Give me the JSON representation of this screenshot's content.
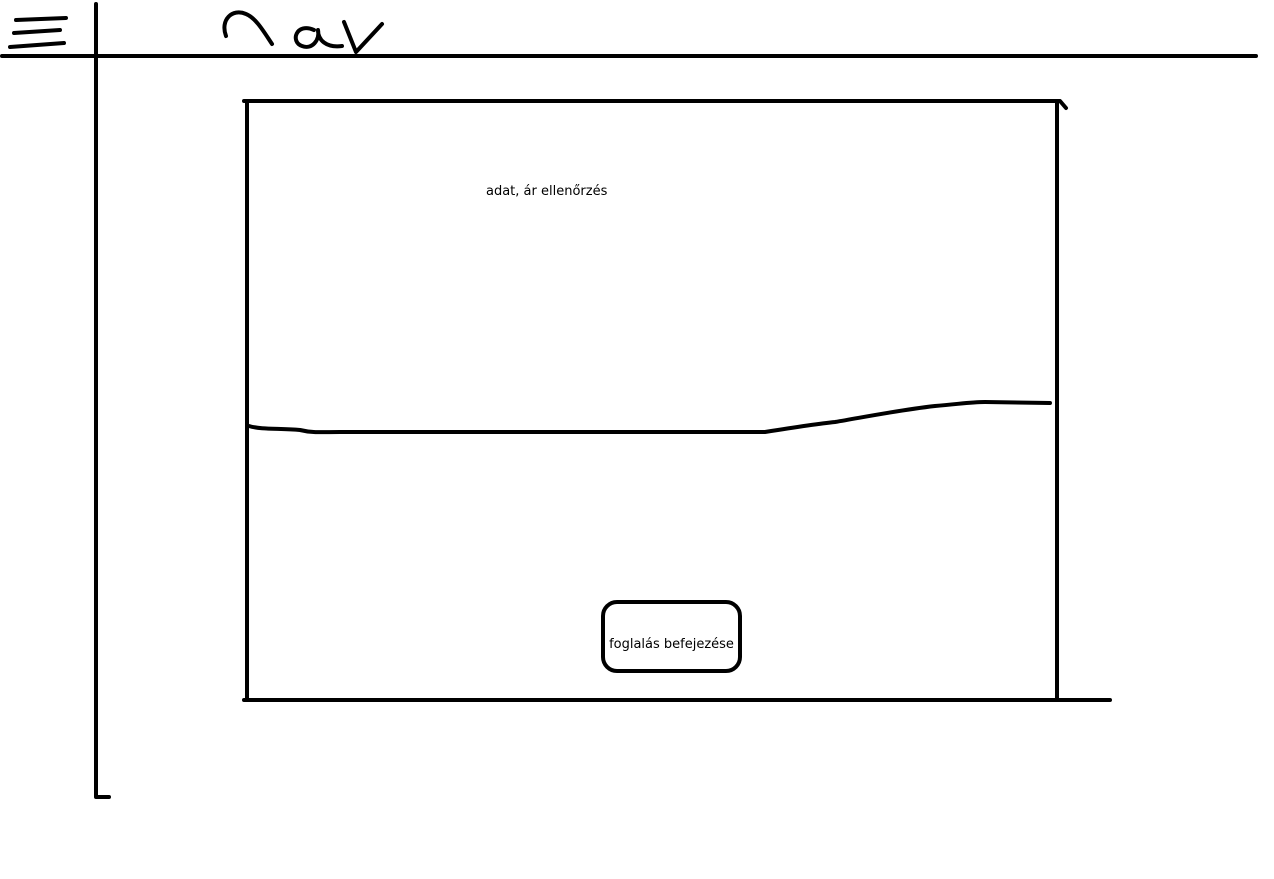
{
  "header": {
    "menu_icon": "hamburger-menu-icon",
    "title": "nav"
  },
  "main": {
    "check_label": "adat, ár ellenőrzés",
    "finish_button_label": "foglalás befejezése"
  },
  "colors": {
    "ink": "#000000",
    "background": "#ffffff"
  }
}
